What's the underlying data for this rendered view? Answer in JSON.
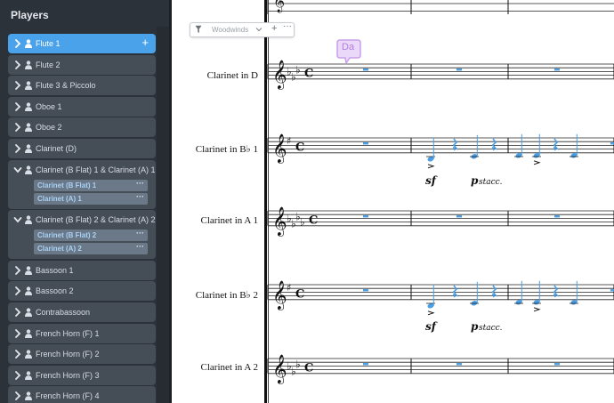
{
  "panel": {
    "title": "Players",
    "players": [
      {
        "name": "Flute 1",
        "selected": true,
        "expanded": false
      },
      {
        "name": "Flute 2",
        "selected": false,
        "expanded": false
      },
      {
        "name": "Flute 3 & Piccolo",
        "selected": false,
        "expanded": false
      },
      {
        "name": "Oboe 1",
        "selected": false,
        "expanded": false
      },
      {
        "name": "Oboe 2",
        "selected": false,
        "expanded": false
      },
      {
        "name": "Clarinet (D)",
        "selected": false,
        "expanded": false
      },
      {
        "name": "Clarinet (B Flat) 1 & Clarinet (A) 1",
        "selected": false,
        "expanded": true,
        "instruments": [
          "Clarinet (B Flat) 1",
          "Clarinet (A) 1"
        ]
      },
      {
        "name": "Clarinet (B Flat) 2 & Clarinet (A) 2",
        "selected": false,
        "expanded": true,
        "instruments": [
          "Clarinet (B Flat) 2",
          "Clarinet (A) 2"
        ]
      },
      {
        "name": "Bassoon 1",
        "selected": false,
        "expanded": false
      },
      {
        "name": "Bassoon 2",
        "selected": false,
        "expanded": false
      },
      {
        "name": "Contrabassoon",
        "selected": false,
        "expanded": false
      },
      {
        "name": "French Horn (F) 1",
        "selected": false,
        "expanded": false
      },
      {
        "name": "French Horn (F) 2",
        "selected": false,
        "expanded": false
      },
      {
        "name": "French Horn (F) 3",
        "selected": false,
        "expanded": false
      },
      {
        "name": "French Horn (F) 4",
        "selected": false,
        "expanded": false
      }
    ],
    "add_symbol": "+",
    "more_symbol": "···"
  },
  "score": {
    "filter": {
      "label": "Woodwinds",
      "add_symbol": "+",
      "more_symbol": "···"
    },
    "bubble_text": "Da",
    "staves": [
      {
        "name": "Clarinet in D"
      },
      {
        "name": "Clarinet in B♭ 1"
      },
      {
        "name": "Clarinet in A 1"
      },
      {
        "name": "Clarinet in B♭ 2"
      },
      {
        "name": "Clarinet in A 2"
      }
    ],
    "dynamics": [
      {
        "text": "sf"
      },
      {
        "text": "p"
      },
      {
        "text": "stacc."
      },
      {
        "text": "sf"
      },
      {
        "text": "p"
      },
      {
        "text": "stacc."
      }
    ],
    "time_signature": "C",
    "colors": {
      "selection_blue": "#4a9ee6",
      "bubble_purple": "#c9a0ea"
    }
  }
}
